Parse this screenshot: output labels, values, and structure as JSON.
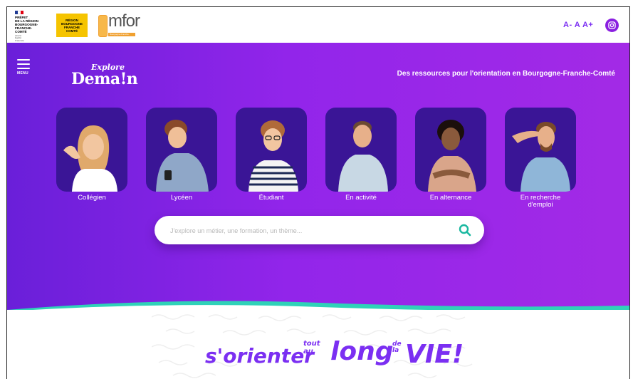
{
  "header": {
    "prefet_lines": "PRÉFET\nDE LA RÉGION\nBOURGOGNE-\nFRANCHE-COMTÉ",
    "prefet_motto": "Liberté\nÉgalité\nFraternité",
    "region_logo": "RÉGION\nBOURGOGNE\nFRANCHE\nCOMTÉ",
    "emfor_logo": "mfor",
    "emfor_sub": "Bourgogne-Franche-Comté",
    "font_controls": "A- A A+",
    "instagram_icon": "instagram-icon",
    "colors": {
      "accent": "#7b2ff2",
      "instagram": "#8a1fe0",
      "region": "#f5c400"
    }
  },
  "hero": {
    "menu_label": "MENU",
    "brand_top": "Explore",
    "brand_bottom": "Dema!n",
    "tagline": "Des ressources pour l'orientation en Bourgogne-Franche-Comté",
    "profiles": [
      {
        "label": "Collégien"
      },
      {
        "label": "Lycéen"
      },
      {
        "label": "Étudiant"
      },
      {
        "label": "En activité"
      },
      {
        "label": "En alternance"
      },
      {
        "label": "En recherche\nd'emploi"
      }
    ],
    "search": {
      "placeholder": "J'explore un métier, une formation, un thème..."
    },
    "colors": {
      "gradient_start": "#6a1fd9",
      "gradient_end": "#a32ae6",
      "wave": "#2fd2b8"
    }
  },
  "slogan": {
    "part1": "s'orienter",
    "part2": "tout\nau",
    "part3": "long",
    "part4": "de\nla",
    "part5": "VIE!"
  }
}
